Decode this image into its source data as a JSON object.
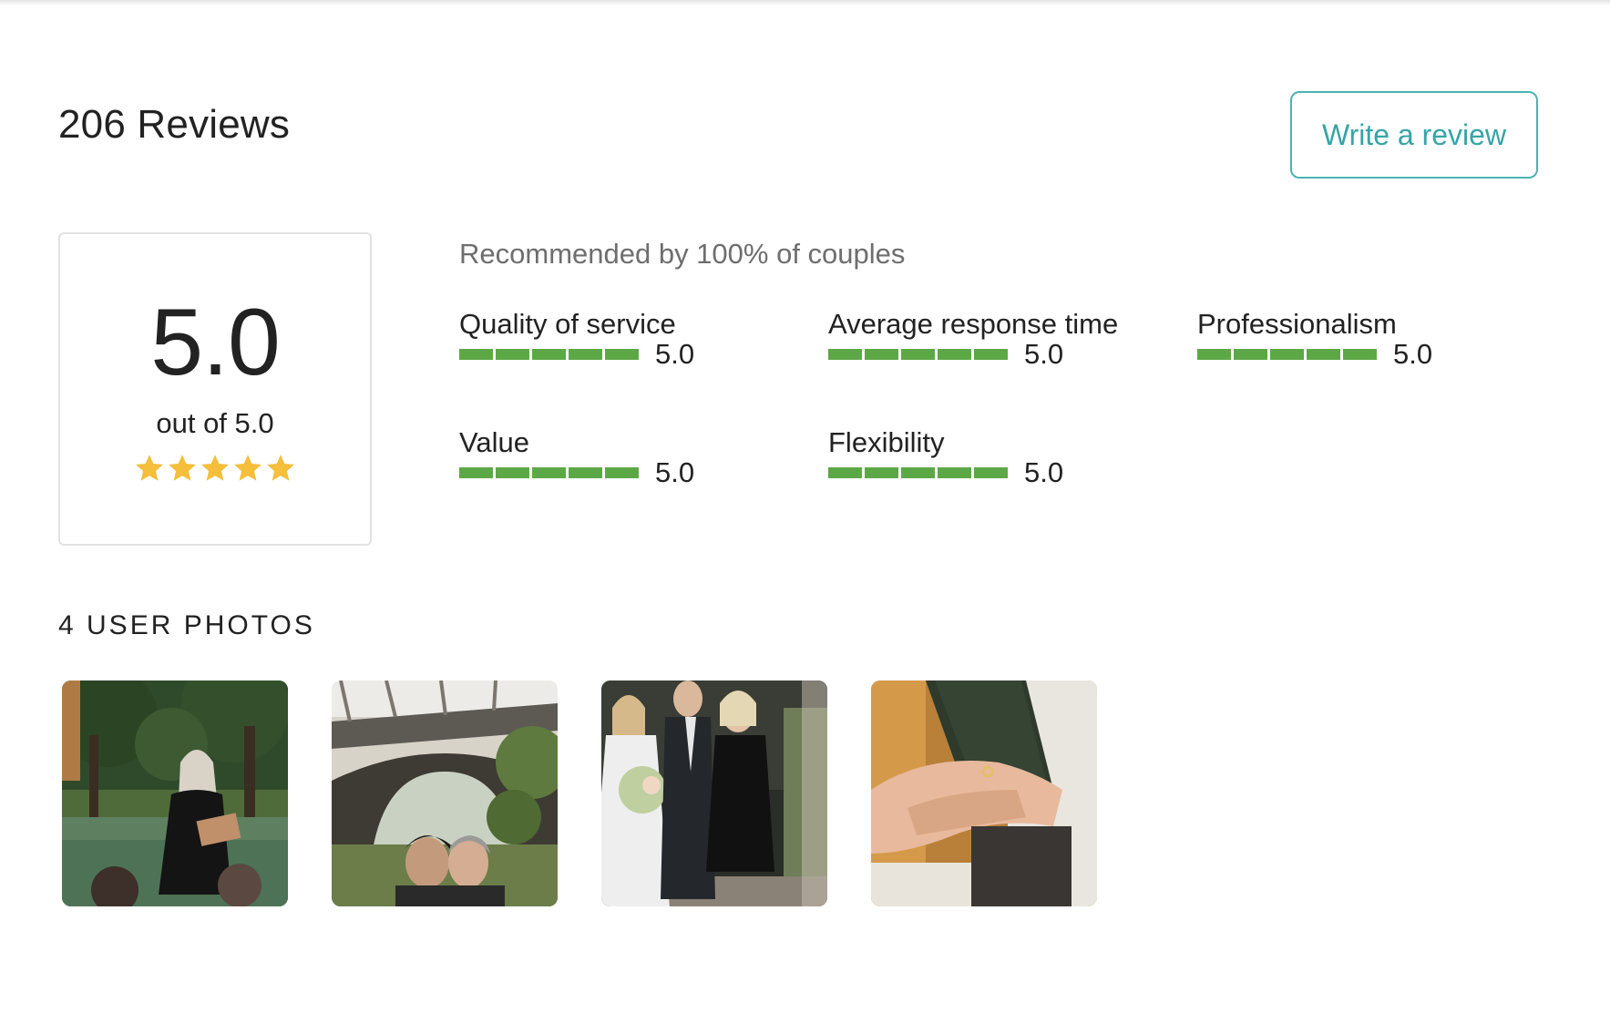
{
  "header": {
    "reviews_title": "206 Reviews",
    "write_review_label": "Write a review"
  },
  "summary": {
    "score": "5.0",
    "out_of": "out of 5.0",
    "stars": 5,
    "recommended": "Recommended by 100% of couples"
  },
  "ratings": [
    {
      "label": "Quality of service",
      "value": "5.0",
      "fraction": 1.0
    },
    {
      "label": "Average response time",
      "value": "5.0",
      "fraction": 1.0
    },
    {
      "label": "Professionalism",
      "value": "5.0",
      "fraction": 1.0
    },
    {
      "label": "Value",
      "value": "5.0",
      "fraction": 1.0
    },
    {
      "label": "Flexibility",
      "value": "5.0",
      "fraction": 1.0
    }
  ],
  "photos": {
    "title": "4 USER PHOTOS",
    "items": [
      "photo-officiant-reading",
      "photo-couple-kiss-bridge",
      "photo-wedding-group",
      "photo-ring-exchange"
    ]
  },
  "colors": {
    "accent": "#37a4a6",
    "bar": "#5da846",
    "star": "#f5be3b"
  }
}
